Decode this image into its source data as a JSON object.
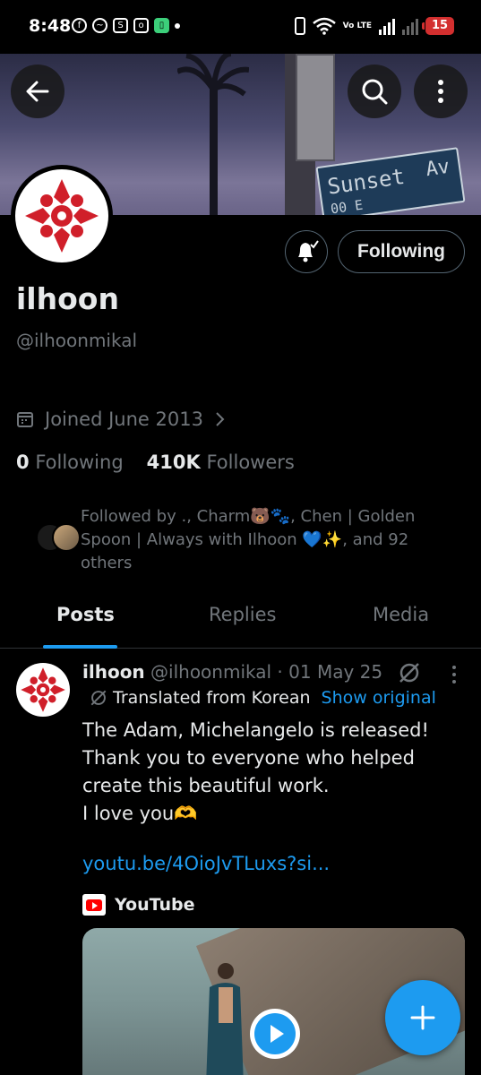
{
  "status_bar": {
    "time": "8:48",
    "network_label": "Vo LTE",
    "battery": "15"
  },
  "banner": {
    "street_sign": {
      "name": "Sunset",
      "suffix": "Av",
      "number": "00 E"
    }
  },
  "profile": {
    "display_name": "ilhoon",
    "handle": "@ilhoonmikal",
    "follow_button_label": "Following",
    "joined": "Joined June 2013",
    "following_count": "0",
    "following_label": "Following",
    "followers_count": "410K",
    "followers_label": "Followers",
    "followed_by": "Followed by ., Charm🐻🐾, Chen | Golden Spoon | Always with Ilhoon 💙✨, and 92 others"
  },
  "tabs": [
    {
      "label": "Posts",
      "active": true
    },
    {
      "label": "Replies",
      "active": false
    },
    {
      "label": "Media",
      "active": false
    }
  ],
  "post": {
    "author_name": "ilhoon",
    "author_handle": "@ilhoonmikal",
    "date": "· 01 May 25",
    "translated_label": "Translated from Korean",
    "show_original": "Show original",
    "text": "The Adam, Michelangelo is released!\nThank you to everyone who helped create this beautiful work.\nI love you🫶",
    "link": "youtu.be/4OioJvTLuxs?si...",
    "card_source": "YouTube"
  },
  "colors": {
    "accent": "#1d9bf0",
    "background": "#000000",
    "secondary_text": "#71767b"
  },
  "icons": [
    "back-arrow-icon",
    "search-icon",
    "more-vertical-icon",
    "bell-icon",
    "calendar-icon",
    "chevron-right-icon",
    "grok-icon",
    "translate-icon",
    "youtube-icon",
    "play-icon",
    "plus-icon"
  ]
}
